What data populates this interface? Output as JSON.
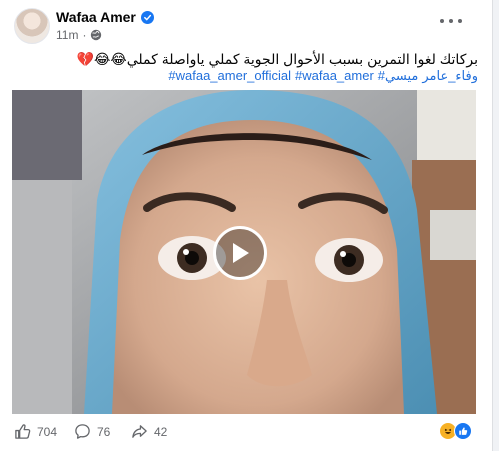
{
  "post": {
    "author": "Wafaa Amer",
    "timestamp": "11m",
    "caption": "بركاتك لغوا التمرين بسبب الأحوال الجوية كملي ياواصلة كملي😂😂💔",
    "hashtags": [
      "#wafaa_amer_official",
      "#wafaa_amer",
      "#ميسي",
      "وفاء_عامر"
    ],
    "icons": {
      "verified": "verified-badge-icon",
      "audience": "globe-icon",
      "menu": "more-options-icon",
      "video": "play-icon",
      "reactions": [
        "like-icon",
        "comment-icon",
        "share-icon",
        "haha-reaction-icon",
        "like-reaction-icon"
      ]
    }
  },
  "stats": {
    "likes": "704",
    "comments": "76",
    "shares": "42"
  },
  "colors": {
    "accent": "#1877f2",
    "link": "#216fdb",
    "muted": "#65676b",
    "scarf": "#6fb1d3"
  }
}
